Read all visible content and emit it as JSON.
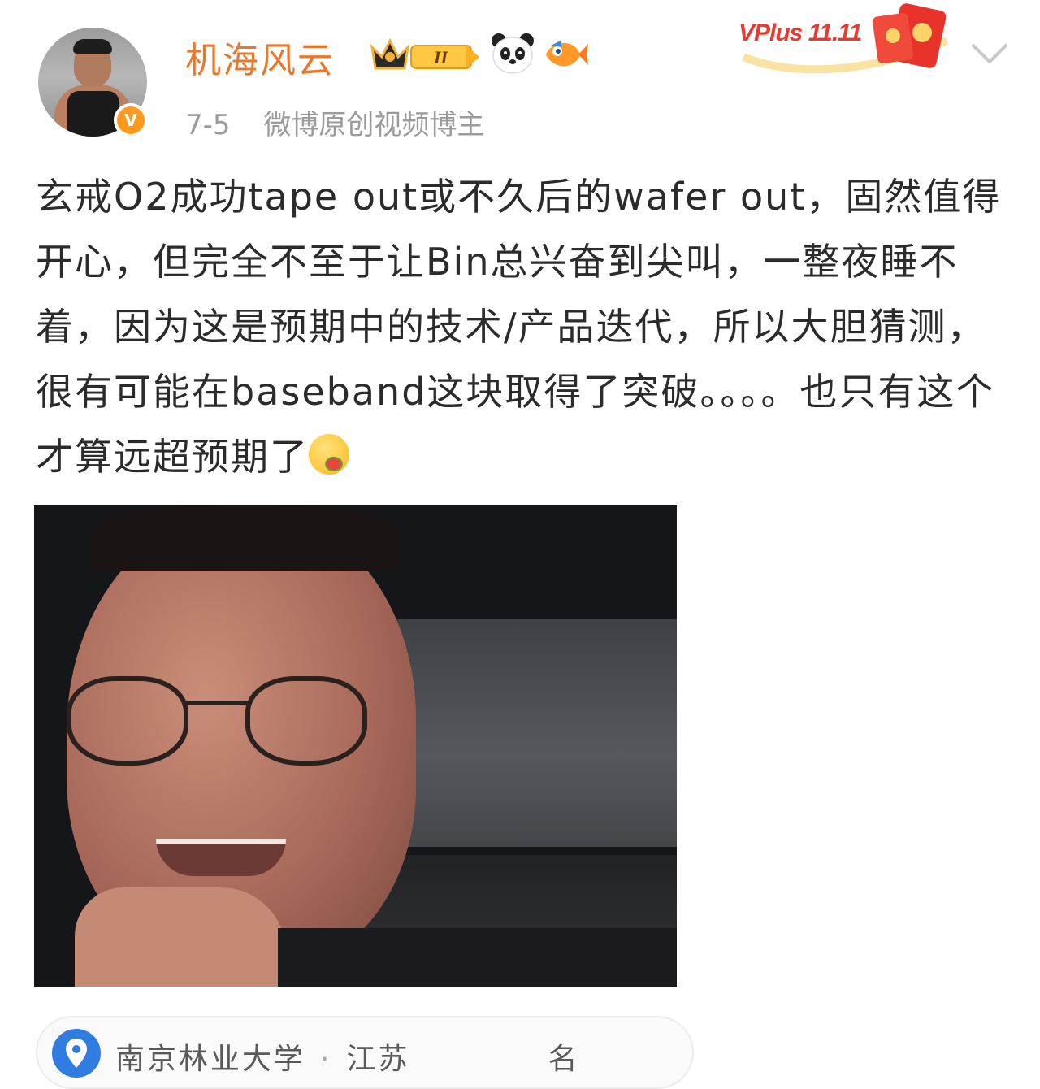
{
  "post": {
    "author": {
      "name": "机海风云",
      "verified_symbol": "V"
    },
    "date": "7-5",
    "author_tag": "微博原创视频博主",
    "promo_label": "VPlus 11.11",
    "text": "玄戒O2成功tape out或不久后的wafer out，固然值得开心，但完全不至于让Bin总兴奋到尖叫，一整夜睡不着，因为这是预期中的技术/产品迭代，所以大胆猜测，很有可能在baseband这块取得了突破。。。。也只有这个才算远超预期了",
    "location": {
      "place": "南京林业大学",
      "separator": "·",
      "region": "江苏",
      "trailing": "名"
    }
  },
  "colors": {
    "username": "#e8782a",
    "meta": "#9b9b9b",
    "text": "#2b2b2b",
    "pin": "#2f7de1",
    "verified": "#ff9a1e"
  },
  "icons": {
    "verified": "verified-v-icon",
    "vip": "vip-level-2-crown-icon",
    "panda": "panda-icon",
    "fish": "fish-icon",
    "expand": "chevron-down-icon",
    "emoji": "watermelon-smile-emoji",
    "location": "location-pin-icon"
  }
}
